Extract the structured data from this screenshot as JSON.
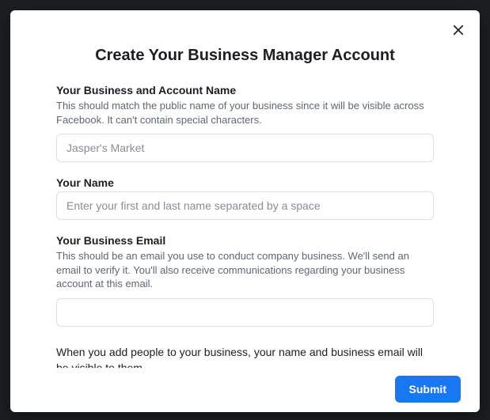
{
  "modal": {
    "title": "Create Your Business Manager Account",
    "close": "close"
  },
  "fields": {
    "business_name": {
      "label": "Your Business and Account Name",
      "description": "This should match the public name of your business since it will be visible across Facebook. It can't contain special characters.",
      "placeholder": "Jasper's Market",
      "value": ""
    },
    "your_name": {
      "label": "Your Name",
      "description": "",
      "placeholder": "Enter your first and last name separated by a space",
      "value": ""
    },
    "business_email": {
      "label": "Your Business Email",
      "description": "This should be an email you use to conduct company business. We'll send an email to verify it. You'll also receive communications regarding your business account at this email.",
      "placeholder": "",
      "value": ""
    }
  },
  "notice": "When you add people to your business, your name and business email will be visible to them.",
  "footer": {
    "submit_label": "Submit"
  }
}
